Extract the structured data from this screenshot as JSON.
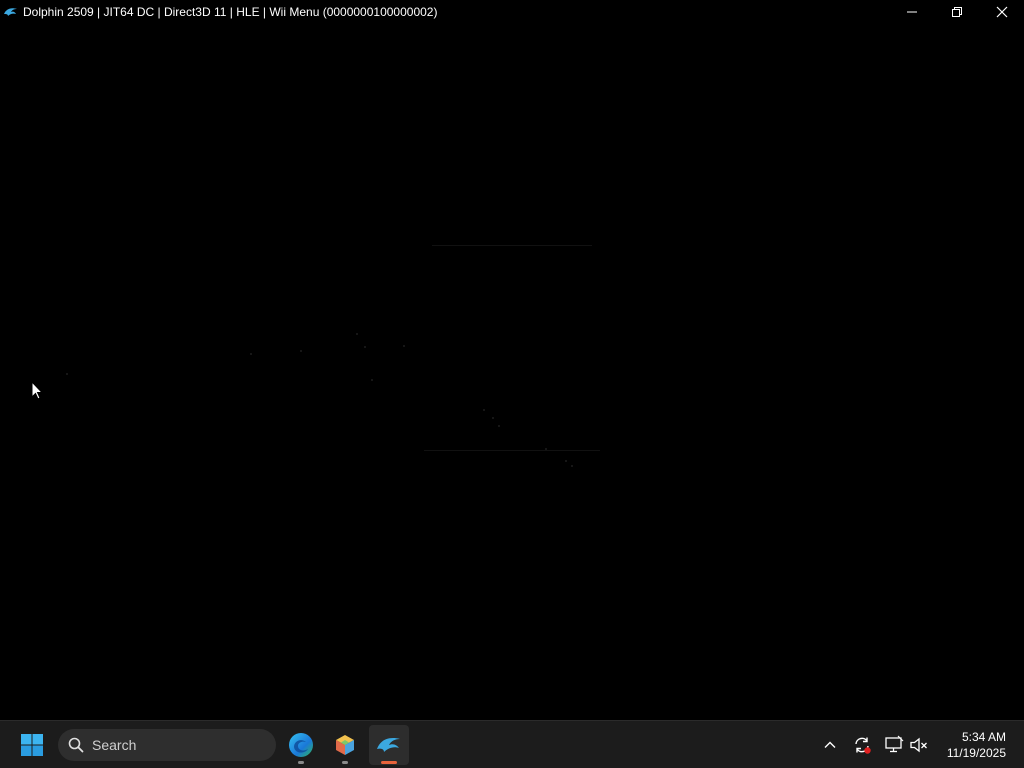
{
  "window": {
    "title": "Dolphin 2509 | JIT64 DC | Direct3D 11 | HLE | Wii Menu (0000000100000002)",
    "app_icon": "dolphin-icon",
    "controls": [
      "minimize-icon",
      "restore-icon",
      "close-icon"
    ]
  },
  "taskbar": {
    "start_icon": "windows-logo-icon",
    "search": {
      "label": "Search",
      "icon": "search-icon"
    },
    "apps": [
      {
        "name": "Microsoft Edge",
        "icon": "edge-icon",
        "active": false
      },
      {
        "name": "Package app",
        "icon": "box-app-icon",
        "active": false
      },
      {
        "name": "Dolphin",
        "icon": "dolphin-icon",
        "active": true
      }
    ],
    "tray": {
      "icons": [
        "chevron-up-icon",
        "sync-icon",
        "network-icon",
        "speaker-muted-icon"
      ]
    },
    "clock": {
      "time": "5:34 AM",
      "date": "11/19/2025"
    }
  },
  "colors": {
    "accent_active_indicator": "#e8643c",
    "taskbar_bg": "#1c1c1c",
    "window_bg": "#000000",
    "dolphin_blue": "#3ba8e0"
  }
}
